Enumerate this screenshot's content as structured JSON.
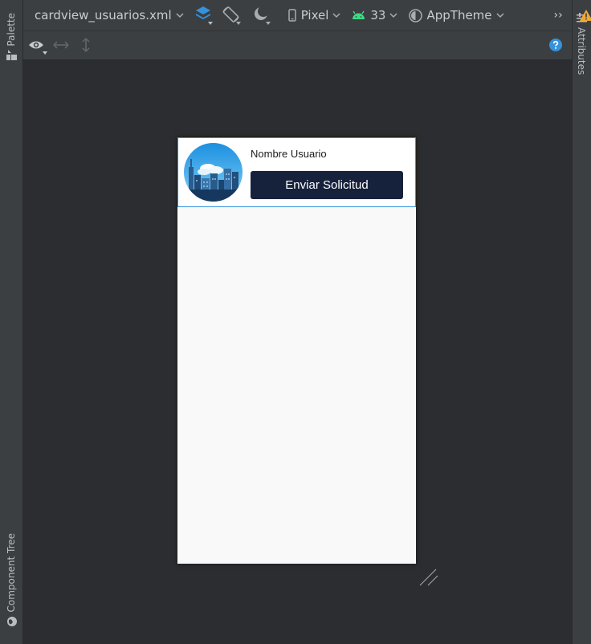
{
  "left_panel": {
    "palette_label": "Palette",
    "component_tree_label": "Component Tree"
  },
  "right_panel": {
    "attributes_label": "Attributes"
  },
  "toolbar": {
    "file_name": "cardview_usuarios.xml",
    "device": "Pixel",
    "api_level": "33",
    "theme": "AppTheme",
    "overflow": "››"
  },
  "card": {
    "user_name": "Nombre Usuario",
    "button_label": "Enviar Solicitud"
  },
  "colors": {
    "accent_blue": "#3592dd",
    "android_green": "#3ddc84",
    "warning_orange": "#f0a732",
    "button_navy": "#16213b"
  }
}
